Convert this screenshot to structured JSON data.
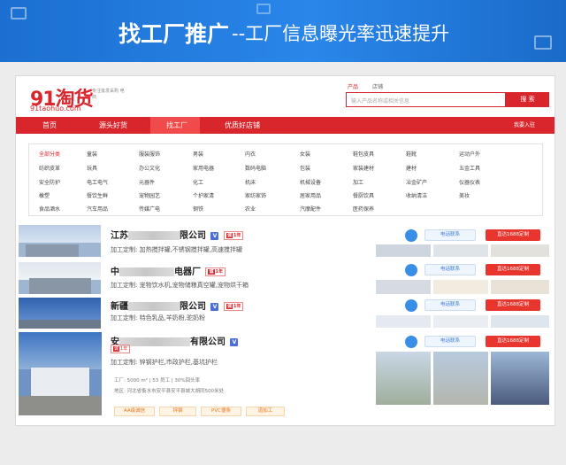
{
  "banner": {
    "title": "找工厂推广",
    "subtitle": "--工厂信息曝光率迅速提升"
  },
  "header": {
    "logo_text": "91淘货",
    "logo_sub": "91taohuo.com",
    "slogan": "专注批发采购 电商",
    "search_tabs": [
      "产品",
      "店铺"
    ],
    "search_placeholder": "输入产品名称或相关信息",
    "search_button": "搜 索"
  },
  "nav": {
    "items": [
      "首页",
      "源头好货",
      "找工厂",
      "优质好店铺"
    ],
    "active": "找工厂",
    "right_link": "我要入驻"
  },
  "categories": [
    [
      "全部分类",
      "童装",
      "服装服饰",
      "男装",
      "内衣",
      "女装",
      "鞋包皮具",
      "鞋靴",
      "运动户外"
    ],
    [
      "纺织皮革",
      "玩具",
      "办公文化",
      "家用电器",
      "数码电脑",
      "包装",
      "家装建材",
      "建材",
      "五金工具"
    ],
    [
      "安全防护",
      "电工电气",
      "元器件",
      "化工",
      "机床",
      "机械设备",
      "加工",
      "冶金矿产",
      "仪器仪表"
    ],
    [
      "橡塑",
      "餐饮生鲜",
      "宠物园艺",
      "个护家清",
      "家纺家饰",
      "居家用品",
      "餐厨饮具",
      "收纳清洁",
      "美妆"
    ],
    [
      "食品酒水",
      "汽车用品",
      "传媒广电",
      "钢铁",
      "农业",
      "汽摩配件",
      "医药保养"
    ]
  ],
  "listings": [
    {
      "name_start": "江苏",
      "name_end": "限公司",
      "desc": "加工定制:  加热搅拌罐,不锈钢搅拌罐,高速搅拌罐"
    },
    {
      "name_start": "中",
      "name_end": "电器厂",
      "desc": "加工定制:  宠物饮水机,宠物储粮真空罐,宠物烘干箱"
    },
    {
      "name_start": "新疆",
      "name_end": "限公司",
      "desc": "加工定制:  特色乳品,羊奶粉,驼奶粉"
    },
    {
      "name_start": "安",
      "name_end": "有限公司",
      "desc": "加工定制:  锌钢护栏,市政护栏,基坑护栏",
      "stats": "工厂: 5000 m²   |   53 员工   |   30%回头率",
      "address": "地区: 河北省衡水市安平县安平县城大胡同500米处",
      "tags": [
        "AA级诚信",
        "锌钢",
        "PVC便条",
        "道加工"
      ]
    }
  ],
  "buttons": {
    "contact": "电话联系",
    "visit": "直达1688定制"
  },
  "badges": {
    "verified": "V",
    "years_prefix": "诚",
    "years": "1年"
  },
  "colors": {
    "brand_red": "#d8262c",
    "banner_blue": "#1b6fd0",
    "contact_blue": "#3a7bd5"
  }
}
